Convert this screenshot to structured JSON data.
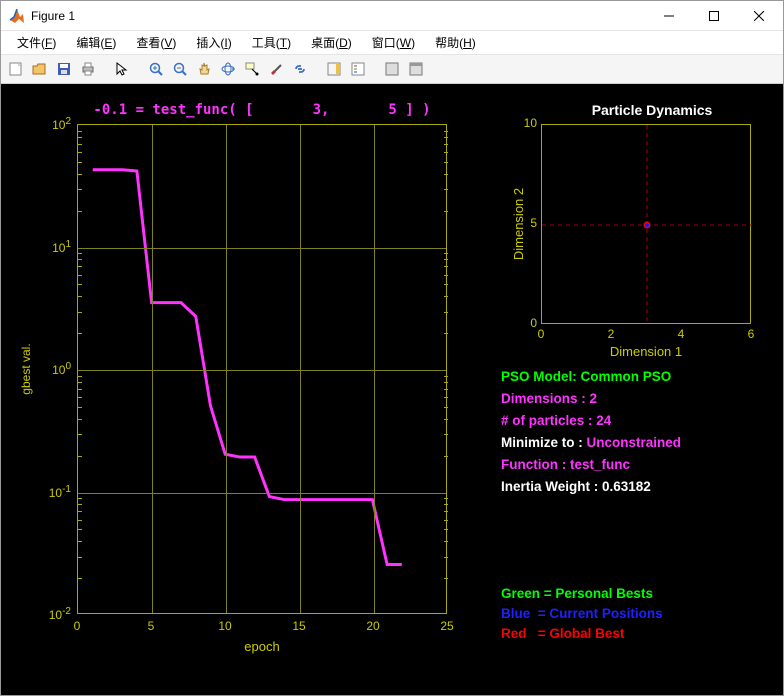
{
  "window": {
    "title": "Figure 1"
  },
  "menu": {
    "file": "文件(F)",
    "edit": "编辑(E)",
    "view": "查看(V)",
    "insert": "插入(I)",
    "tools": "工具(T)",
    "desktop": "桌面(D)",
    "window": "窗口(W)",
    "help": "帮助(H)"
  },
  "chart_data": [
    {
      "id": "main",
      "type": "line",
      "title": "-0.1 = test_func( [       3,       5 ] )",
      "xlabel": "epoch",
      "ylabel": "gbest val.",
      "xscale": "linear",
      "yscale": "log",
      "xlim": [
        0,
        25
      ],
      "ylim": [
        0.01,
        100
      ],
      "xticks": [
        0,
        5,
        10,
        15,
        20,
        25
      ],
      "ytick_labels": [
        "10^-2",
        "10^-1",
        "10^0",
        "10^1",
        "10^2"
      ],
      "yticks_exp": [
        -2,
        -1,
        0,
        1,
        2
      ],
      "grid": true,
      "series": [
        {
          "name": "gbest",
          "color": "#ff33ff",
          "x": [
            1,
            2,
            3,
            4,
            5,
            6,
            7,
            8,
            9,
            10,
            11,
            12,
            13,
            14,
            15,
            16,
            17,
            18,
            19,
            20,
            21,
            22
          ],
          "values": [
            43,
            43,
            43,
            42,
            3.5,
            3.5,
            3.5,
            2.7,
            0.5,
            0.2,
            0.19,
            0.19,
            0.09,
            0.085,
            0.085,
            0.085,
            0.085,
            0.085,
            0.085,
            0.085,
            0.025,
            0.025
          ]
        }
      ]
    },
    {
      "id": "particles",
      "type": "scatter",
      "title": "Particle Dynamics",
      "xlabel": "Dimension 1",
      "ylabel": "Dimension 2",
      "xlim": [
        0,
        6
      ],
      "ylim": [
        0,
        10
      ],
      "xticks": [
        0,
        2,
        4,
        6
      ],
      "yticks": [
        0,
        5,
        10
      ],
      "crosshair": {
        "x": 3,
        "y": 5,
        "color": "#aa0000"
      },
      "points": [
        {
          "name": "global_best",
          "x": 3,
          "y": 5,
          "color": "#ff0000",
          "size": 7
        },
        {
          "name": "current",
          "x": 3,
          "y": 5,
          "color": "#1818ff",
          "size": 4
        }
      ]
    }
  ],
  "info": {
    "model_label": "PSO Model: ",
    "model_value": "Common PSO",
    "dims_label": "Dimensions : ",
    "dims_value": "2",
    "npart_label": "# of particles : ",
    "npart_value": "24",
    "min_label": "Minimize to : ",
    "min_value": "Unconstrained",
    "func_label": "Function : ",
    "func_value": "test_func",
    "inertia_label": "Inertia Weight : ",
    "inertia_value": "0.63182"
  },
  "legend": {
    "green": "Green = Personal Bests",
    "blue": "Blue  = Current Positions",
    "red": "Red   = Global Best"
  }
}
